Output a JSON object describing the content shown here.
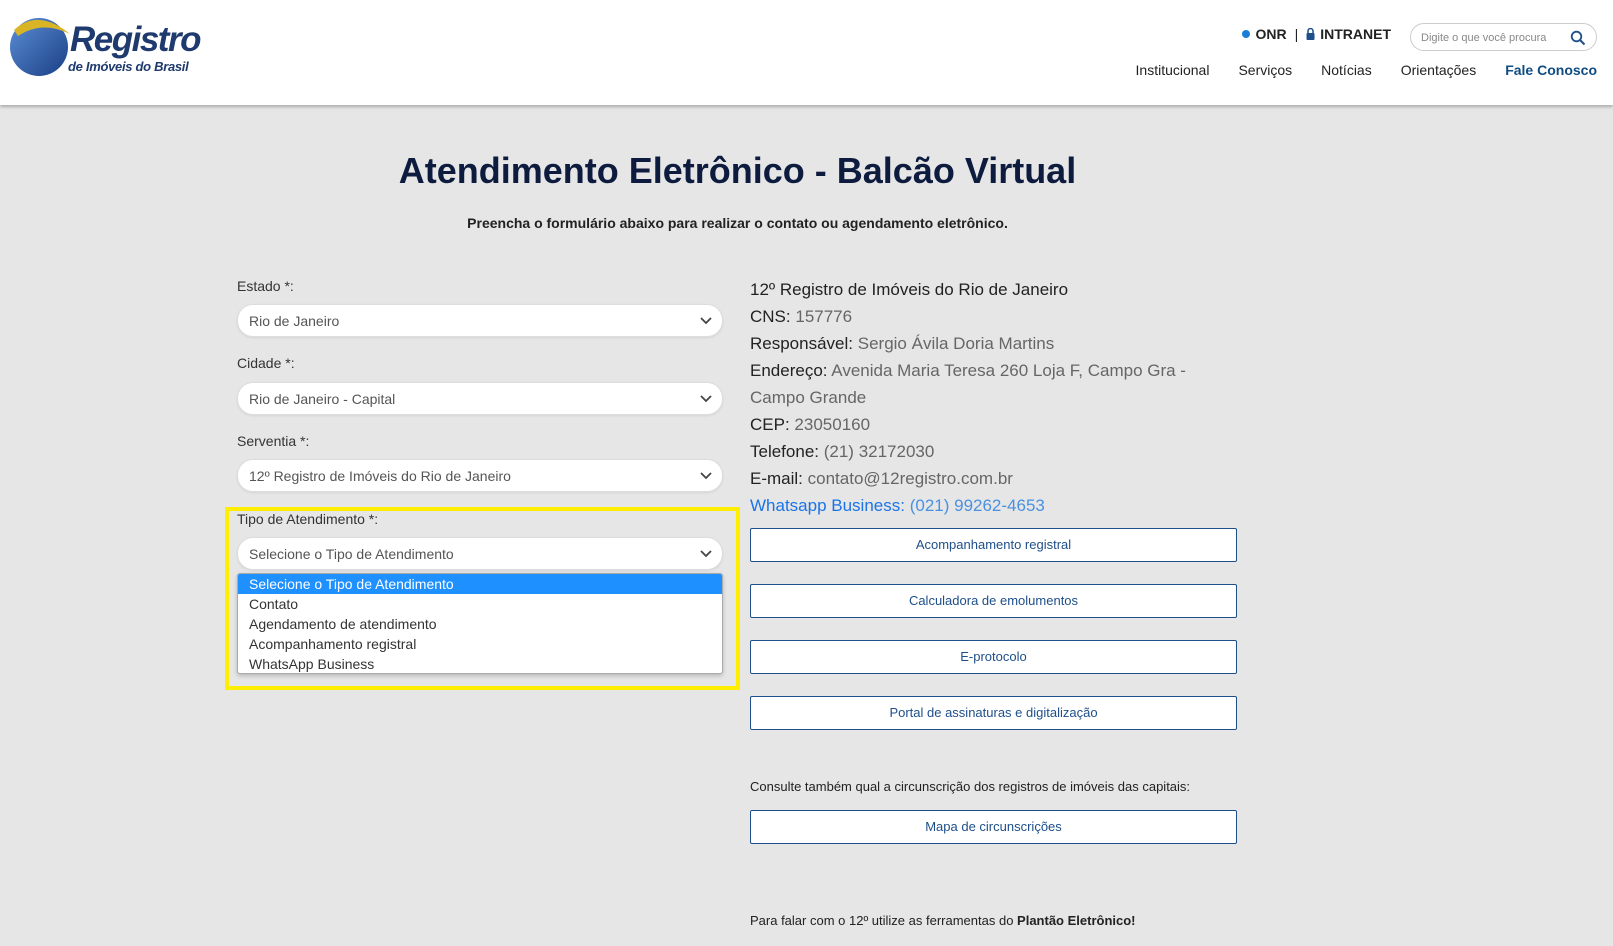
{
  "header": {
    "logo_text": "Registro",
    "logo_subtext": "de Imóveis do Brasil",
    "onr_label": "ONR",
    "intranet_label": "INTRANET",
    "search_placeholder": "Digite o que você procura",
    "nav": [
      {
        "label": "Institucional"
      },
      {
        "label": "Serviços"
      },
      {
        "label": "Notícias"
      },
      {
        "label": "Orientações"
      },
      {
        "label": "Fale Conosco"
      }
    ],
    "accent_color": "#0f4c81"
  },
  "page": {
    "title": "Atendimento Eletrônico - Balcão Virtual",
    "subtitle": "Preencha o formulário abaixo para realizar o contato ou agendamento eletrônico."
  },
  "form": {
    "estado": {
      "label": "Estado *:",
      "value": "Rio de Janeiro"
    },
    "cidade": {
      "label": "Cidade *:",
      "value": "Rio de Janeiro - Capital"
    },
    "serventia": {
      "label": "Serventia *:",
      "value": "12º Registro de Imóveis do Rio de Janeiro"
    },
    "tipo": {
      "label": "Tipo de Atendimento *:",
      "value": "Selecione o Tipo de Atendimento",
      "options": [
        "Selecione o Tipo de Atendimento",
        "Contato",
        "Agendamento de atendimento",
        "Acompanhamento registral",
        "WhatsApp Business"
      ]
    }
  },
  "info": {
    "name": "12º Registro de Imóveis do Rio de Janeiro",
    "cns_label": "CNS:",
    "cns_value": "157776",
    "responsavel_label": "Responsável:",
    "responsavel_value": "Sergio Ávila Doria Martins",
    "endereco_label": "Endereço:",
    "endereco_value": "Avenida Maria Teresa 260 Loja F, Campo Gra -",
    "endereco_value_2": "Campo Grande",
    "cep_label": "CEP:",
    "cep_value": "23050160",
    "telefone_label": "Telefone:",
    "telefone_value": "(21) 32172030",
    "email_label": "E-mail:",
    "email_value": "contato@12registro.com.br",
    "whatsapp_label": "Whatsapp Business:",
    "whatsapp_value": "(021) 99262-4653"
  },
  "buttons": {
    "acompanhamento": "Acompanhamento registral",
    "calculadora": "Calculadora de emolumentos",
    "eprotocolo": "E-protocolo",
    "portal": "Portal de assinaturas e digitalização",
    "mapa": "Mapa de circunscrições"
  },
  "consult_text": "Consulte também qual a circunscrição dos registros de imóveis das capitais:",
  "plantao": {
    "prefix": "Para falar com o 12º utilize as ferramentas do ",
    "bold": "Plantão Eletrônico!"
  },
  "highlight_color": "#ffee00"
}
